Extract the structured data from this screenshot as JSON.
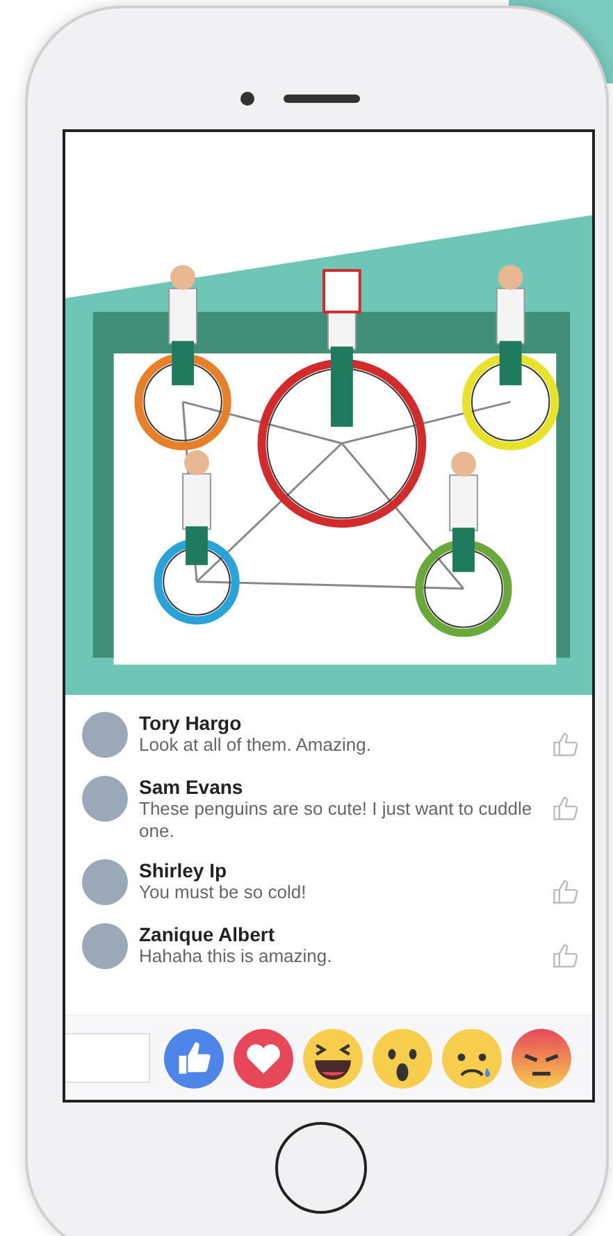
{
  "comments": [
    {
      "name": "Tory Hargo",
      "text": "Look at all of them. Amazing."
    },
    {
      "name": "Sam Evans",
      "text": "These penguins are so cute! I just want to cuddle one."
    },
    {
      "name": "Shirley Ip",
      "text": "You must be so cold!"
    },
    {
      "name": "Zanique Albert",
      "text": "Hahaha this is amazing."
    }
  ],
  "reactions": [
    {
      "kind": "like"
    },
    {
      "kind": "love"
    },
    {
      "kind": "haha"
    },
    {
      "kind": "wow"
    },
    {
      "kind": "sad"
    },
    {
      "kind": "angry"
    }
  ]
}
